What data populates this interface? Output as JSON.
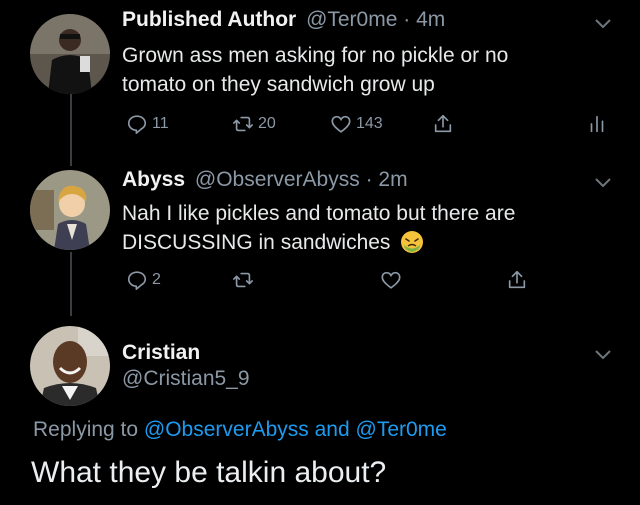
{
  "tweets": [
    {
      "name": "Published Author",
      "handle": "@Ter0me",
      "sep": " · ",
      "time": "4m",
      "lines": [
        "Grown ass men asking for no pickle or no",
        "tomato on they sandwich grow up"
      ],
      "replies": "11",
      "retweets": "20",
      "likes": "143"
    },
    {
      "name": "Abyss",
      "handle": "@ObserverAbyss",
      "sep": " · ",
      "time": "2m",
      "lines": [
        "Nah I like pickles and tomato but there are",
        "DISCUSSING in sandwiches"
      ],
      "emoji": "nauseated-face-icon",
      "replies": "2"
    }
  ],
  "reply": {
    "name": "Cristian",
    "handle": "@Cristian5_9",
    "replying_prefix": "Replying to ",
    "mention1": "@ObserverAbyss",
    "and_word": " and ",
    "mention2": "@Ter0me",
    "text": "What they be talkin about?"
  },
  "colors": {
    "background": "#000000",
    "text": "#e7e9ea",
    "muted": "#8b98a5",
    "link": "#1d9bf0",
    "thread_line": "#3a3d41"
  }
}
